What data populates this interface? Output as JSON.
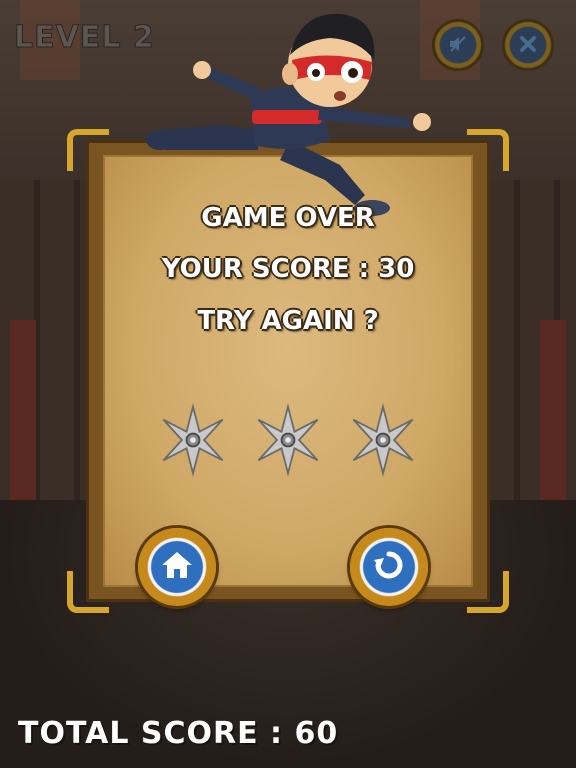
{
  "hud": {
    "level_label": "LEVEL 2",
    "sound_icon": "mute-speaker-icon",
    "close_icon": "close-x-icon"
  },
  "dialog": {
    "line1": "GAME OVER",
    "line2": "YOUR SCORE : 30",
    "line3": "TRY AGAIN ?",
    "stars_icon": "shuriken-star-icon",
    "stars_earned": 0,
    "stars_total": 3,
    "home_icon": "home-icon",
    "retry_icon": "replay-icon"
  },
  "footer": {
    "total_label": "TOTAL SCORE : 60"
  },
  "colors": {
    "panel_wood": "#7a5421",
    "parchment": "#d2ad6c",
    "gold_trim": "#d6a72c",
    "button_blue": "#2f6fc0",
    "shuriken_silver": "#c9c9c9"
  }
}
